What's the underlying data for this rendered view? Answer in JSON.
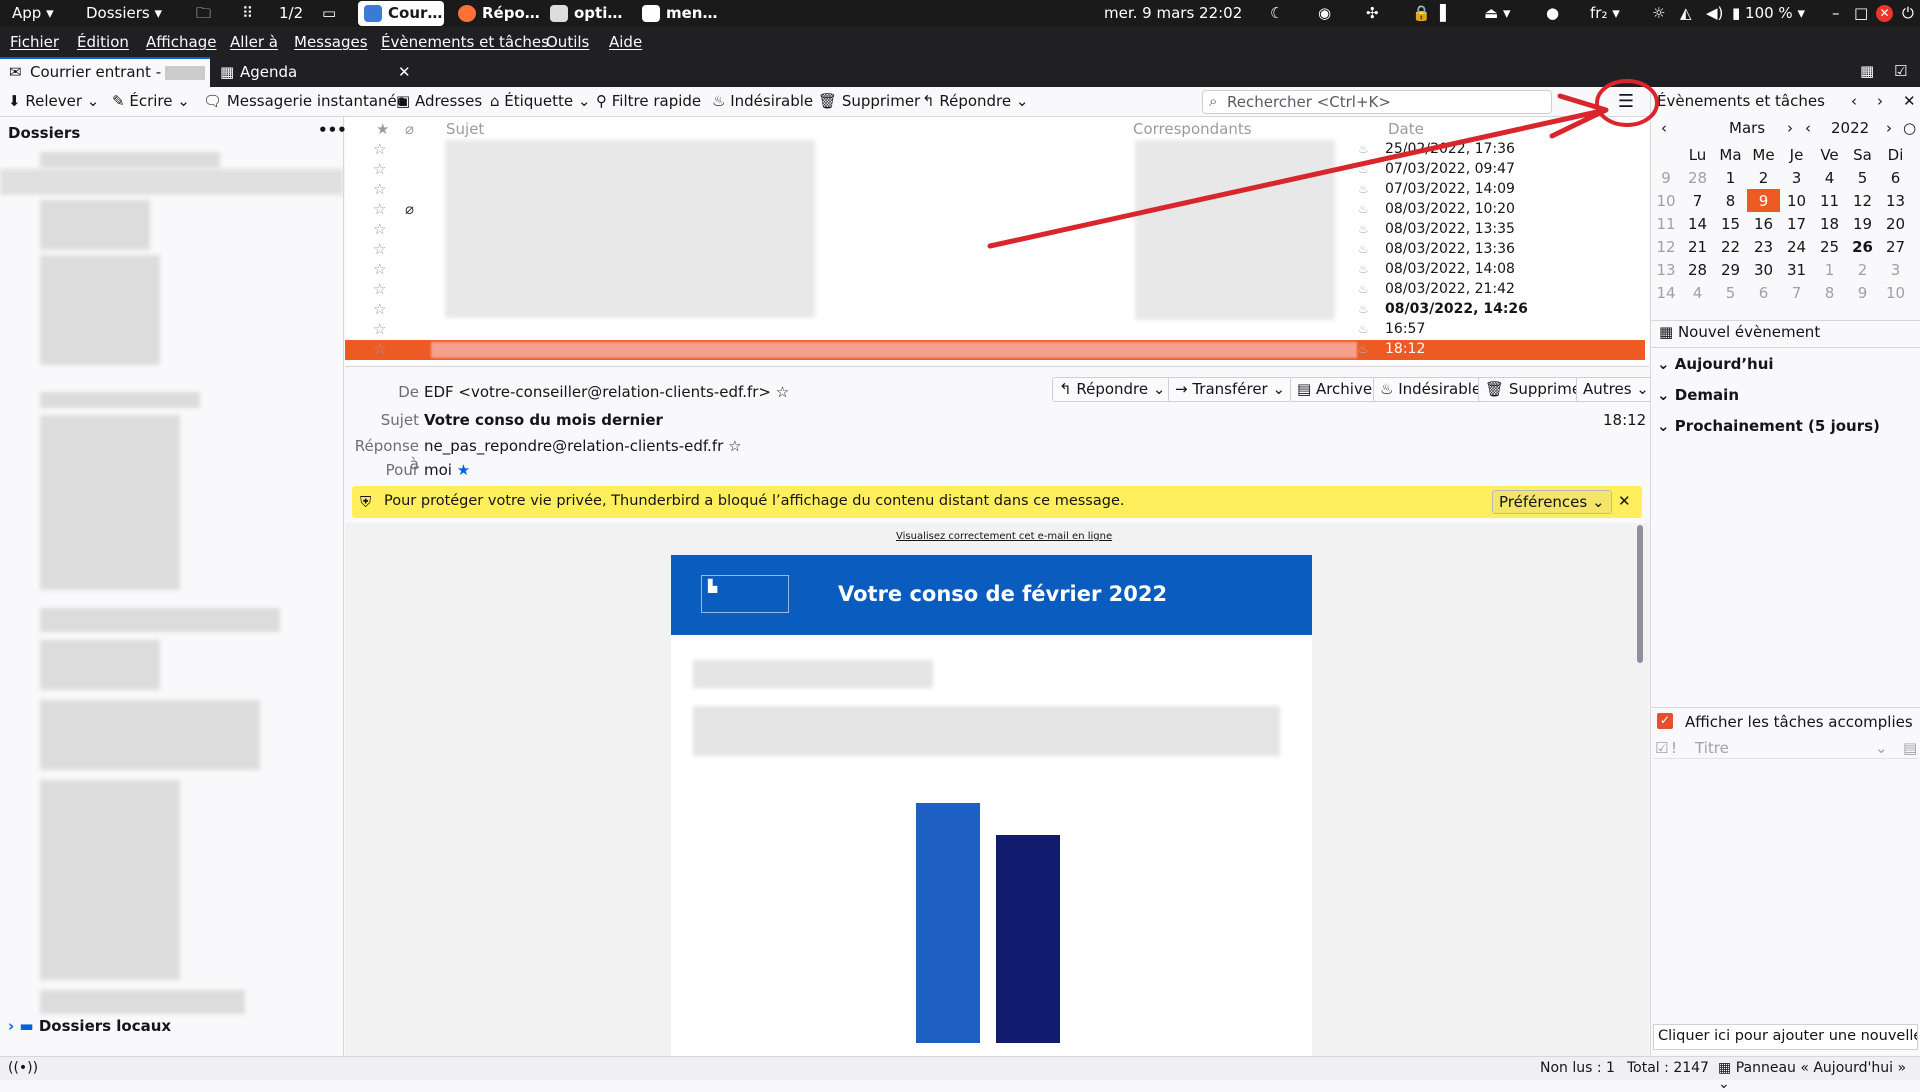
{
  "topbar": {
    "app": "App",
    "dossiers": "Dossiers",
    "workspace": "1/2",
    "tasks": [
      "Cour…",
      "Répo…",
      "opti…",
      "men…"
    ],
    "datetime": "mer. 9 mars  22:02",
    "lang": "fr₂",
    "battery": "100 %"
  },
  "menu": [
    "Fichier",
    "Édition",
    "Affichage",
    "Aller à",
    "Messages",
    "Évènements et tâches",
    "Outils",
    "Aide"
  ],
  "tabs": {
    "mail": "Courrier entrant -",
    "agenda": "Agenda"
  },
  "toolbar": {
    "get": "Relever",
    "write": "Écrire",
    "chat": "Messagerie instantanée",
    "address": "Adresses",
    "tag": "Étiquette",
    "filter": "Filtre rapide",
    "junk": "Indésirable",
    "delete": "Supprimer",
    "reply": "Répondre",
    "search_placeholder": "Rechercher <Ctrl+K>"
  },
  "folders": {
    "title": "Dossiers",
    "local": "Dossiers locaux"
  },
  "columns": {
    "subject": "Sujet",
    "correspondents": "Correspondants",
    "date": "Date"
  },
  "messages": [
    {
      "date": "25/02/2022, 17:36"
    },
    {
      "date": "07/03/2022, 09:47"
    },
    {
      "date": "07/03/2022, 14:09"
    },
    {
      "date": "08/03/2022, 10:20"
    },
    {
      "date": "08/03/2022, 13:35"
    },
    {
      "date": "08/03/2022, 13:36"
    },
    {
      "date": "08/03/2022, 14:08"
    },
    {
      "date": "08/03/2022, 21:42"
    },
    {
      "date": "08/03/2022, 14:26"
    },
    {
      "date": "16:57"
    },
    {
      "date": "18:12"
    }
  ],
  "header": {
    "from_label": "De",
    "from": "EDF <votre-conseiller@relation-clients-edf.fr>",
    "subject_label": "Sujet",
    "subject": "Votre conso du mois dernier",
    "time": "18:12",
    "replyto_label": "Réponse à",
    "replyto": "ne_pas_repondre@relation-clients-edf.fr",
    "to_label": "Pour",
    "to": "moi",
    "buttons": {
      "reply": "Répondre",
      "forward": "Transférer",
      "archive": "Archiver",
      "junk": "Indésirable",
      "delete": "Supprimer",
      "other": "Autres"
    }
  },
  "notice": {
    "text": "Pour protéger votre vie privée, Thunderbird a bloqué l’affichage du contenu distant dans ce message.",
    "prefs": "Préférences"
  },
  "email": {
    "online_link": "Visualisez correctement cet e-mail en ligne",
    "title": "Votre conso de février 2022"
  },
  "today": {
    "title": "Évènements et tâches",
    "month": "Mars",
    "year": "2022",
    "weekdays": [
      "Lu",
      "Ma",
      "Me",
      "Je",
      "Ve",
      "Sa",
      "Di"
    ],
    "new_event": "Nouvel évènement",
    "today": "Aujourd’hui",
    "tomorrow": "Demain",
    "soon": "Prochainement (5 jours)",
    "show_done": "Afficher les tâches accomplies",
    "task_title": "Titre",
    "add_task": "Cliquer ici pour ajouter une nouvelle tâc"
  },
  "status": {
    "unread": "Non lus : 1",
    "total": "Total : 2147",
    "panel": "Panneau « Aujourd'hui »"
  },
  "colors": {
    "accent": "#0061e0",
    "selected": "#ee5a24",
    "notice": "#ffef5c",
    "edf": "#0b5cbf",
    "annotation": "#d9262c"
  }
}
